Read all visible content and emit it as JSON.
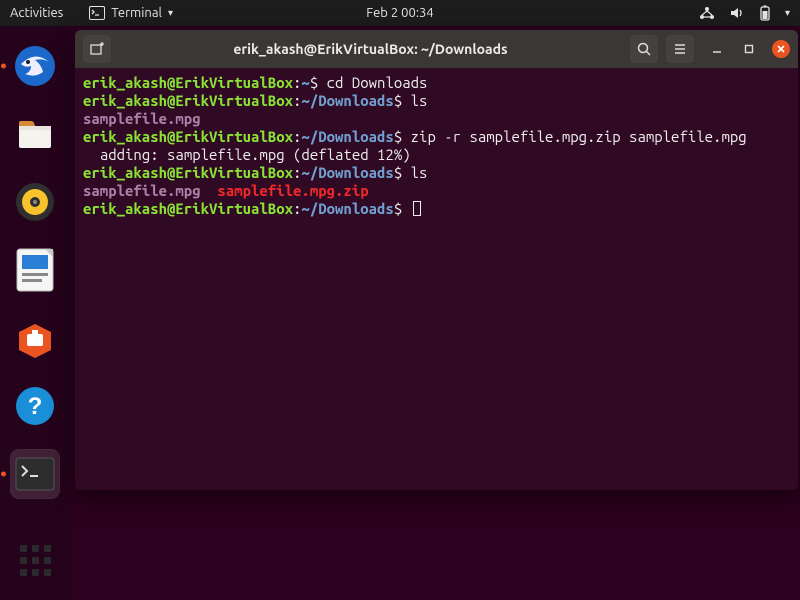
{
  "panel": {
    "activities": "Activities",
    "app_menu_label": "Terminal",
    "clock": "Feb 2  00:34"
  },
  "dock": {
    "items": [
      {
        "name": "thunderbird"
      },
      {
        "name": "files"
      },
      {
        "name": "rhythmbox"
      },
      {
        "name": "libreoffice-writer"
      },
      {
        "name": "ubuntu-software"
      },
      {
        "name": "help"
      },
      {
        "name": "terminal"
      }
    ]
  },
  "window": {
    "title": "erik_akash@ErikVirtualBox: ~/Downloads"
  },
  "term": {
    "user": "erik_akash@ErikVirtualBox",
    "home_path": "~",
    "dl_path": "~/Downloads",
    "cmd1": "cd Downloads",
    "cmd2": "ls",
    "ls1_file": "samplefile.mpg",
    "cmd3": "zip -r samplefile.mpg.zip samplefile.mpg",
    "zip_out": "  adding: samplefile.mpg (deflated 12%)",
    "cmd4": "ls",
    "ls2_file1": "samplefile.mpg",
    "ls2_file2": "samplefile.mpg.zip"
  }
}
